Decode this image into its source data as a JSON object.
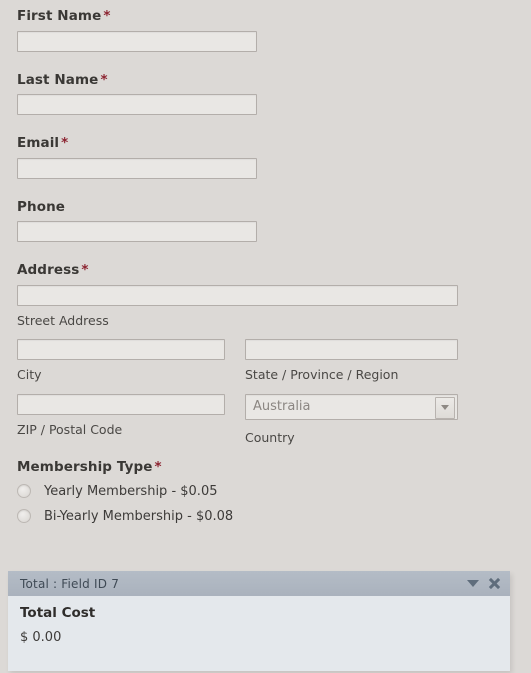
{
  "form": {
    "fields": [
      {
        "label": "First Name",
        "required": true,
        "value": "",
        "placeholder": ""
      },
      {
        "label": "Last Name",
        "required": true,
        "value": "",
        "placeholder": ""
      },
      {
        "label": "Email",
        "required": true,
        "value": "",
        "placeholder": ""
      },
      {
        "label": "Phone",
        "required": false,
        "value": "",
        "placeholder": ""
      }
    ],
    "address": {
      "label": "Address",
      "required": true,
      "street": {
        "sub_label": "Street Address",
        "value": "",
        "placeholder": ""
      },
      "city": {
        "sub_label": "City",
        "value": "",
        "placeholder": ""
      },
      "state": {
        "sub_label": "State / Province / Region",
        "value": "",
        "placeholder": ""
      },
      "zip": {
        "sub_label": "ZIP / Postal Code",
        "value": "",
        "placeholder": ""
      },
      "country": {
        "sub_label": "Country",
        "selected": "Australia",
        "caret_icon": "chevron-down-icon"
      }
    },
    "membership": {
      "label": "Membership Type",
      "required": true,
      "options": [
        {
          "label": "Yearly Membership - $0.05",
          "selected": false
        },
        {
          "label": "Bi-Yearly Membership - $0.08",
          "selected": false
        }
      ]
    },
    "required_marker": "*"
  },
  "total_panel": {
    "header_title": "Total : Field ID 7",
    "collapse_icon": "chevron-down-icon",
    "close_icon": "close-icon",
    "title": "Total Cost",
    "value": "$ 0.00"
  },
  "colors": {
    "page_background": "#dcd9d6",
    "input_background": "#e9e7e4",
    "input_border": "#b3aeaa",
    "required_asterisk": "#8c2330",
    "panel_header": "#aab2bd",
    "panel_body": "#e4e8ec",
    "panel_icon": "#5f6d7c",
    "label_text": "#3a3835"
  }
}
